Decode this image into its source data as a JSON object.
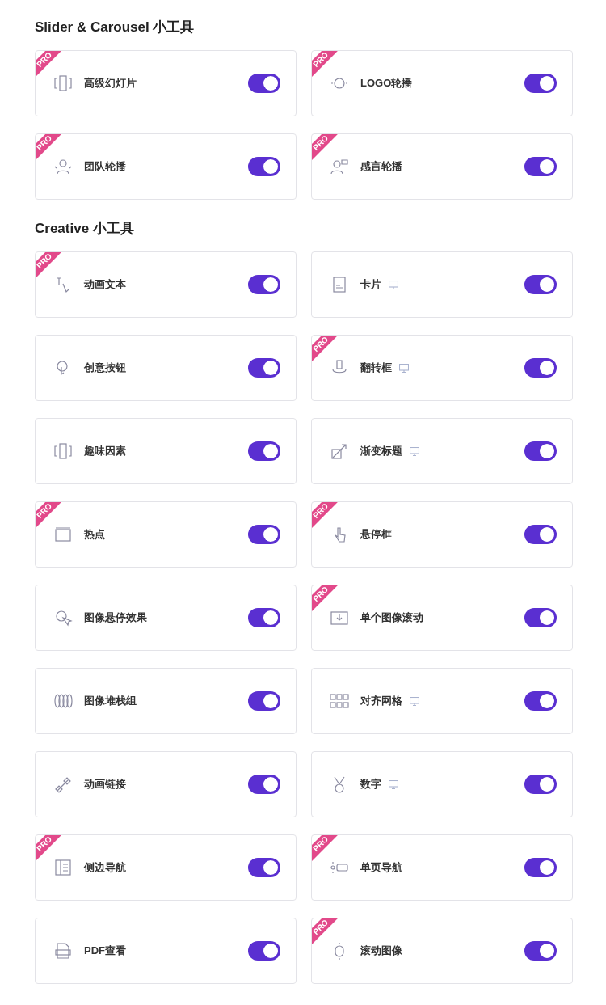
{
  "sections": [
    {
      "title": "Slider & Carousel 小工具",
      "widgets": [
        {
          "label": "高级幻灯片",
          "badge": "PRO",
          "desktop": false,
          "on": true
        },
        {
          "label": "LOGO轮播",
          "badge": "PRO",
          "desktop": false,
          "on": true
        },
        {
          "label": "团队轮播",
          "badge": "PRO",
          "desktop": false,
          "on": true
        },
        {
          "label": "感言轮播",
          "badge": "PRO",
          "desktop": false,
          "on": true
        }
      ]
    },
    {
      "title": "Creative 小工具",
      "widgets": [
        {
          "label": "动画文本",
          "badge": "PRO",
          "desktop": false,
          "on": true
        },
        {
          "label": "卡片",
          "desktop": true,
          "on": true
        },
        {
          "label": "创意按钮",
          "desktop": false,
          "on": true
        },
        {
          "label": "翻转框",
          "badge": "PRO",
          "desktop": true,
          "on": true
        },
        {
          "label": "趣味因素",
          "desktop": false,
          "on": true
        },
        {
          "label": "渐变标题",
          "desktop": true,
          "on": true
        },
        {
          "label": "热点",
          "badge": "PRO",
          "desktop": false,
          "on": true
        },
        {
          "label": "悬停框",
          "badge": "PRO",
          "desktop": false,
          "on": true
        },
        {
          "label": "图像悬停效果",
          "desktop": false,
          "on": true
        },
        {
          "label": "单个图像滚动",
          "badge": "PRO",
          "desktop": false,
          "on": true
        },
        {
          "label": "图像堆栈组",
          "desktop": false,
          "on": true
        },
        {
          "label": "对齐网格",
          "desktop": true,
          "on": true
        },
        {
          "label": "动画链接",
          "desktop": false,
          "on": true
        },
        {
          "label": "数字",
          "desktop": true,
          "on": true
        },
        {
          "label": "侧边导航",
          "badge": "PRO",
          "desktop": false,
          "on": true
        },
        {
          "label": "单页导航",
          "badge": "PRO",
          "desktop": false,
          "on": true
        },
        {
          "label": "PDF查看",
          "desktop": false,
          "on": true
        },
        {
          "label": "滚动图像",
          "badge": "PRO",
          "desktop": false,
          "on": true
        }
      ]
    }
  ]
}
